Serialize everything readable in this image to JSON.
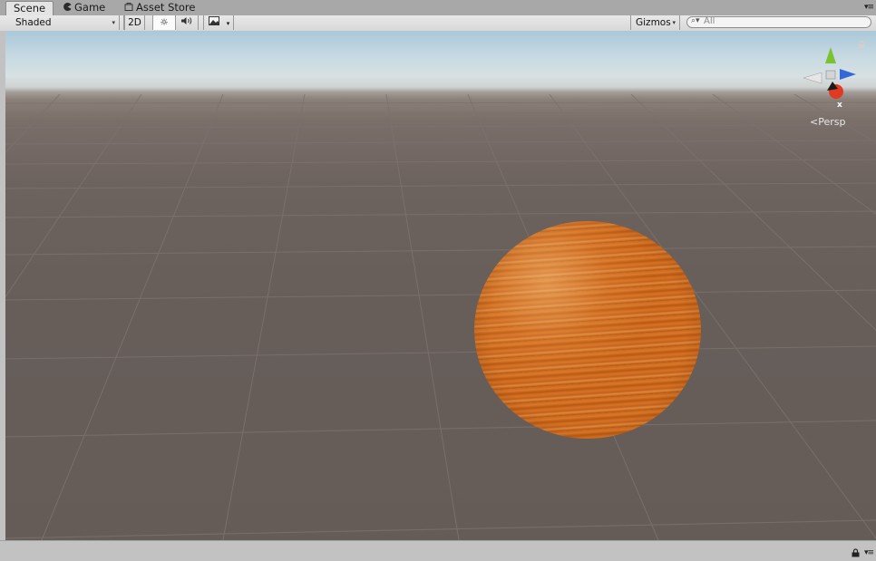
{
  "tabs": [
    {
      "label": "Scene",
      "icon": "scene-tab",
      "active": true
    },
    {
      "label": "Game",
      "icon": "pacman-icon"
    },
    {
      "label": "Asset Store",
      "icon": "store-bag-icon"
    }
  ],
  "panel_menu_glyph": "▾≡",
  "toolbar": {
    "draw_mode": "Shaded",
    "mode_2d": "2D",
    "lighting_glyph": "☼",
    "audio_glyph": "🔊",
    "effects_glyph": "🖼",
    "dropdown_glyph": "▾",
    "gizmos_label": "Gizmos",
    "search_placeholder": "All",
    "search_glyph": "⌕▾"
  },
  "viewport": {
    "persp_label": "<Persp",
    "gizmo_axis_label": "x",
    "sky_color": "#aac8d9",
    "ground_color": "#675e5a",
    "sphere_color": "#c86a22",
    "gizmo_colors": {
      "x": "#e03a22",
      "y": "#7ac232",
      "z": "#3468d8"
    }
  },
  "status": {
    "lock_glyph": "🔒",
    "menu_glyph": "▾≡"
  }
}
